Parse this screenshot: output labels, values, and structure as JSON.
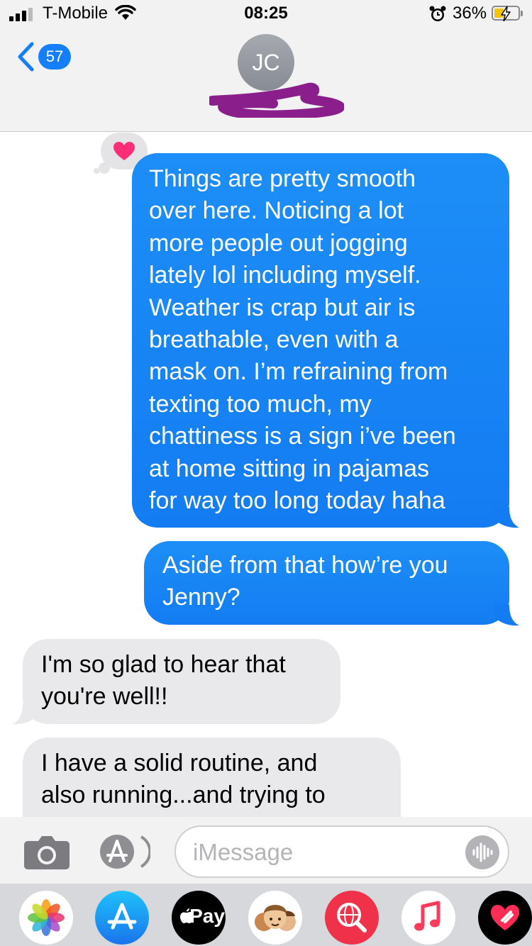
{
  "status_bar": {
    "carrier": "T-Mobile",
    "time": "08:25",
    "battery_percent": "36%",
    "signal_bars": 3,
    "charging": true
  },
  "header": {
    "back_count": "57",
    "contact_initials": "JC"
  },
  "messages": [
    {
      "direction": "out",
      "text": "Things are pretty smooth\nover here. Noticing a lot\nmore people out jogging\nlately lol including myself.\nWeather is crap but air is\nbreathable, even with a\nmask on. I’m refraining from\ntexting too much, my\nchattiness is a sign i’ve been\nat home sitting in pajamas\nfor way too long today haha",
      "tapback": "heart-icon"
    },
    {
      "direction": "out",
      "text": "Aside from that how’re you\nJenny?"
    },
    {
      "direction": "in",
      "text": "I'm so glad to hear that\nyou're well!!"
    },
    {
      "direction": "in",
      "text": "I have a solid routine, and\nalso running...and trying to"
    }
  ],
  "compose": {
    "placeholder": "iMessage"
  },
  "app_drawer": {
    "apps": [
      "photos-icon",
      "app-store-icon",
      "apple-pay-icon",
      "memoji-icon",
      "web-search-icon",
      "music-icon",
      "digital-touch-icon"
    ],
    "apple_pay_label": "Pay"
  },
  "colors": {
    "outgoing_bubble": "#147efb",
    "incoming_bubble": "#e9e9eb",
    "tapback_heart": "#ff2d78",
    "redaction": "#8a1f8c"
  }
}
